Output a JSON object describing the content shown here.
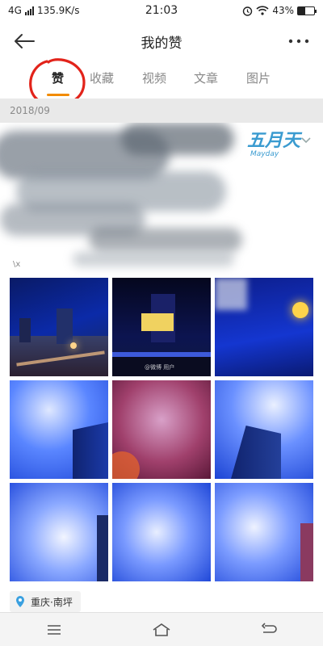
{
  "status": {
    "network": "4G",
    "speed": "135.9K/s",
    "time": "21:03",
    "battery": "43%",
    "icons": [
      "signal-icon",
      "alarm-icon",
      "wifi-icon",
      "battery-icon"
    ]
  },
  "header": {
    "title": "我的赞",
    "back_icon": "arrow-left-icon",
    "more_icon": "more-dots-icon"
  },
  "tabs": [
    {
      "label": "赞",
      "active": true
    },
    {
      "label": "收藏",
      "active": false
    },
    {
      "label": "视频",
      "active": false
    },
    {
      "label": "文章",
      "active": false
    },
    {
      "label": "图片",
      "active": false
    }
  ],
  "date": "2018/09",
  "card": {
    "sticker_text": "五月天",
    "sticker_sub": "Mayday",
    "caption_mark": "\\x"
  },
  "photos": [
    {
      "theme": "night-street"
    },
    {
      "theme": "night-city",
      "watermark": "@微博 用户"
    },
    {
      "theme": "blue-night-lamp"
    },
    {
      "theme": "sky-tower"
    },
    {
      "theme": "pink-clouds"
    },
    {
      "theme": "sky-tower-2"
    },
    {
      "theme": "sky-clouds"
    },
    {
      "theme": "sky-clouds-2"
    },
    {
      "theme": "sky-clouds-3"
    }
  ],
  "location": "重庆·南坪",
  "colors": {
    "accent": "#f28b00",
    "annotation": "#e2231a",
    "sticker": "#3a9bd0"
  }
}
